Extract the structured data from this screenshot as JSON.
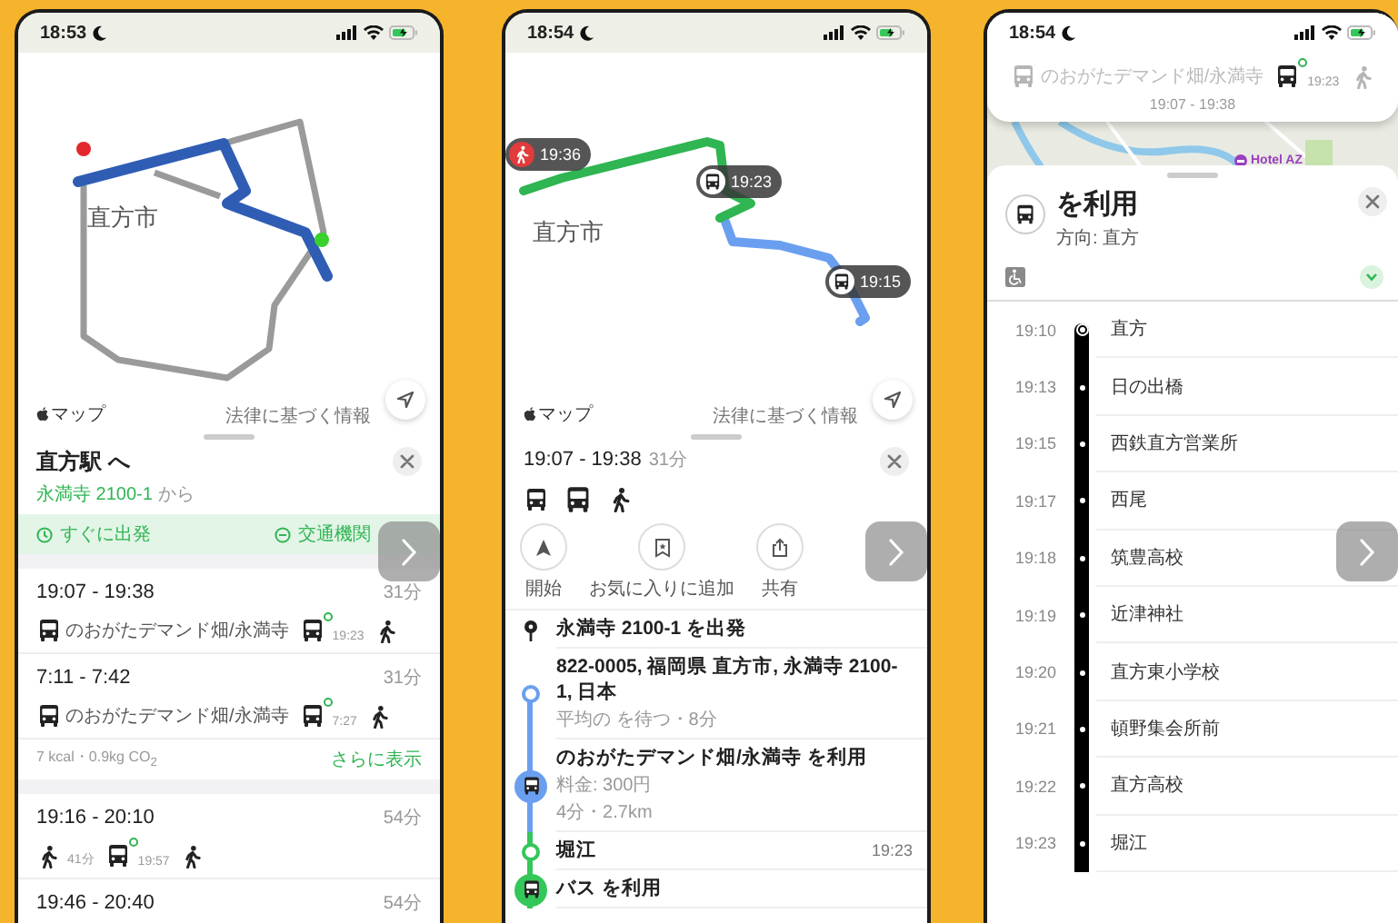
{
  "route_options": {
    "status": {
      "time": "18:53"
    },
    "map": {
      "city_label": "直方市",
      "brand": "マップ",
      "legal": "法律に基づく情報"
    },
    "title": "直方駅 へ",
    "origin": "永満寺 2100-1",
    "origin_suffix": "から",
    "depart_now": "すぐに出発",
    "transit_mode": "交通機関",
    "routes": [
      {
        "times": "19:07 - 19:38",
        "duration": "31分",
        "steps": [
          {
            "kind": "bus",
            "label": "のおがたデマンド畑/永満寺",
            "live": false
          },
          {
            "kind": "bus",
            "time": "19:23",
            "live": true
          },
          {
            "kind": "walk"
          }
        ]
      },
      {
        "times": "7:11 - 7:42",
        "duration": "31分",
        "steps": [
          {
            "kind": "bus",
            "label": "のおがたデマンド畑/永満寺",
            "live": false
          },
          {
            "kind": "bus",
            "time": "7:27",
            "live": true
          },
          {
            "kind": "walk"
          }
        ],
        "note": "7 kcal・0.9kg CO$_{2}$",
        "more": "さらに表示"
      },
      {
        "times": "19:16 - 20:10",
        "duration": "54分",
        "steps": [
          {
            "kind": "walk",
            "label": "41分"
          },
          {
            "kind": "bus",
            "time": "19:57",
            "live": true
          },
          {
            "kind": "walk"
          }
        ]
      },
      {
        "times": "19:46 - 20:40",
        "duration": "54分"
      }
    ]
  },
  "route_detail": {
    "status": {
      "time": "18:54"
    },
    "map": {
      "city_label": "直方市",
      "brand": "マップ",
      "legal": "法律に基づく情報",
      "callouts": [
        {
          "kind": "walk",
          "time": "19:36"
        },
        {
          "kind": "bus",
          "time": "19:23"
        },
        {
          "kind": "bus",
          "time": "19:15"
        }
      ]
    },
    "times": "19:07 - 19:38",
    "duration": "31分",
    "modes": [
      {
        "kind": "bus"
      },
      {
        "kind": "bus_large"
      },
      {
        "kind": "walk"
      }
    ],
    "actions": [
      {
        "kind": "start",
        "label": "開始"
      },
      {
        "kind": "favorite",
        "label": "お気に入りに追加"
      },
      {
        "kind": "share",
        "label": "共有"
      }
    ],
    "steps": [
      {
        "kind": "origin",
        "title": "永満寺 2100-1 を出発"
      },
      {
        "kind": "place",
        "title": "822-0005, 福岡県 直方市, 永満寺 2100-1, 日本",
        "lines": [
          "平均の を待つ・8分"
        ],
        "color": "#6a9ff0"
      },
      {
        "kind": "ride",
        "title": "のおがたデマンド畑/永満寺 を利用",
        "lines": [
          "料金: 300円",
          "4分・2.7km"
        ],
        "color": "#6a9ff0"
      },
      {
        "kind": "stop",
        "title": "堀江",
        "time": "19:23",
        "color": "#34c759"
      },
      {
        "kind": "ride",
        "title": "バス を利用",
        "color": "#34c759"
      }
    ]
  },
  "line_detail": {
    "status": {
      "time": "18:54"
    },
    "trip": [
      {
        "kind": "bus",
        "label": "のおがたデマンド畑/永満寺",
        "live": false,
        "active": false
      },
      {
        "kind": "bus",
        "time": "19:23",
        "live": true,
        "active": true
      },
      {
        "kind": "walk",
        "active": false
      }
    ],
    "trip_times": "19:07 - 19:38",
    "poi": "Hotel AZ",
    "title": "を利用",
    "direction": "方向: 直方",
    "stops": [
      {
        "time": "19:10",
        "name": "直方"
      },
      {
        "time": "19:13",
        "name": "日の出橋"
      },
      {
        "time": "19:15",
        "name": "西鉄直方営業所"
      },
      {
        "time": "19:17",
        "name": "西尾"
      },
      {
        "time": "19:18",
        "name": "筑豊高校"
      },
      {
        "time": "19:19",
        "name": "近津神社"
      },
      {
        "time": "19:20",
        "name": "直方東小学校"
      },
      {
        "time": "19:21",
        "name": "頓野集会所前"
      },
      {
        "time": "19:22",
        "name": "直方高校"
      },
      {
        "time": "19:23",
        "name": "堀江"
      }
    ]
  }
}
